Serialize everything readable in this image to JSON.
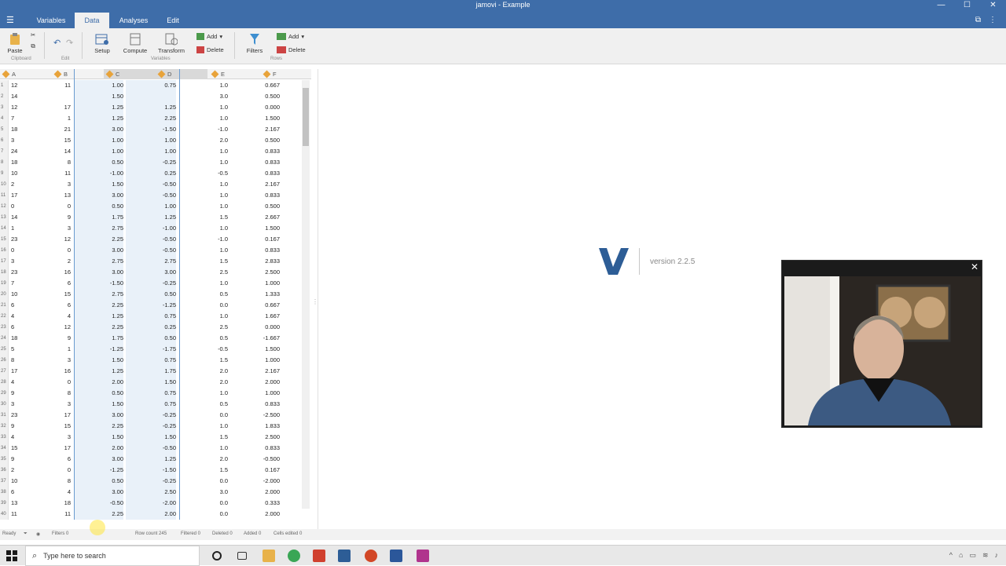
{
  "window": {
    "title": "jamovi - Example",
    "minimize": "—",
    "maximize": "☐",
    "close": "✕"
  },
  "tabs": [
    "Variables",
    "Data",
    "Analyses",
    "Edit"
  ],
  "active_tab": "Data",
  "ribbon": {
    "paste": "Paste",
    "clipboard_group": "Clipboard",
    "edit_group": "Edit",
    "setup": "Setup",
    "compute": "Compute",
    "transform": "Transform",
    "variables_group": "Variables",
    "var_add": "Add",
    "var_delete": "Delete",
    "filters": "Filters",
    "row_add": "Add",
    "row_delete": "Delete",
    "rows_group": "Rows"
  },
  "columns": [
    "A",
    "B",
    "C",
    "D",
    "E",
    "F"
  ],
  "rows": [
    [
      "1",
      "12",
      "11",
      "1.00",
      "0.75",
      "1.0",
      "0.667"
    ],
    [
      "2",
      "14",
      "",
      "1.50",
      "",
      "3.0",
      "0.500"
    ],
    [
      "3",
      "12",
      "17",
      "1.25",
      "1.25",
      "1.0",
      "0.000"
    ],
    [
      "4",
      "7",
      "1",
      "1.25",
      "2.25",
      "1.0",
      "1.500"
    ],
    [
      "5",
      "18",
      "21",
      "3.00",
      "-1.50",
      "-1.0",
      "2.167"
    ],
    [
      "6",
      "3",
      "15",
      "1.00",
      "1.00",
      "2.0",
      "0.500"
    ],
    [
      "7",
      "24",
      "14",
      "1.00",
      "1.00",
      "1.0",
      "0.833"
    ],
    [
      "8",
      "18",
      "8",
      "0.50",
      "-0.25",
      "1.0",
      "0.833"
    ],
    [
      "9",
      "10",
      "11",
      "-1.00",
      "0.25",
      "-0.5",
      "0.833"
    ],
    [
      "10",
      "2",
      "3",
      "1.50",
      "-0.50",
      "1.0",
      "2.167"
    ],
    [
      "11",
      "17",
      "13",
      "3.00",
      "-0.50",
      "1.0",
      "0.833"
    ],
    [
      "12",
      "0",
      "0",
      "0.50",
      "1.00",
      "1.0",
      "0.500"
    ],
    [
      "13",
      "14",
      "9",
      "1.75",
      "1.25",
      "1.5",
      "2.667"
    ],
    [
      "14",
      "1",
      "3",
      "2.75",
      "-1.00",
      "1.0",
      "1.500"
    ],
    [
      "15",
      "23",
      "12",
      "2.25",
      "-0.50",
      "-1.0",
      "0.167"
    ],
    [
      "16",
      "0",
      "0",
      "3.00",
      "-0.50",
      "1.0",
      "0.833"
    ],
    [
      "17",
      "3",
      "2",
      "2.75",
      "2.75",
      "1.5",
      "2.833"
    ],
    [
      "18",
      "23",
      "16",
      "3.00",
      "3.00",
      "2.5",
      "2.500"
    ],
    [
      "19",
      "7",
      "6",
      "-1.50",
      "-0.25",
      "1.0",
      "1.000"
    ],
    [
      "20",
      "10",
      "15",
      "2.75",
      "0.50",
      "0.5",
      "1.333"
    ],
    [
      "21",
      "6",
      "6",
      "2.25",
      "-1.25",
      "0.0",
      "0.667"
    ],
    [
      "22",
      "4",
      "4",
      "1.25",
      "0.75",
      "1.0",
      "1.667"
    ],
    [
      "23",
      "6",
      "12",
      "2.25",
      "0.25",
      "2.5",
      "0.000"
    ],
    [
      "24",
      "18",
      "9",
      "1.75",
      "0.50",
      "0.5",
      "-1.667"
    ],
    [
      "25",
      "5",
      "1",
      "-1.25",
      "-1.75",
      "-0.5",
      "1.500"
    ],
    [
      "26",
      "8",
      "3",
      "1.50",
      "0.75",
      "1.5",
      "1.000"
    ],
    [
      "27",
      "17",
      "16",
      "1.25",
      "1.75",
      "2.0",
      "2.167"
    ],
    [
      "28",
      "4",
      "0",
      "2.00",
      "1.50",
      "2.0",
      "2.000"
    ],
    [
      "29",
      "9",
      "8",
      "0.50",
      "0.75",
      "1.0",
      "1.000"
    ],
    [
      "30",
      "3",
      "3",
      "1.50",
      "0.75",
      "0.5",
      "0.833"
    ],
    [
      "31",
      "23",
      "17",
      "3.00",
      "-0.25",
      "0.0",
      "-2.500"
    ],
    [
      "32",
      "9",
      "15",
      "2.25",
      "-0.25",
      "1.0",
      "1.833"
    ],
    [
      "33",
      "4",
      "3",
      "1.50",
      "1.50",
      "1.5",
      "2.500"
    ],
    [
      "34",
      "15",
      "17",
      "2.00",
      "-0.50",
      "1.0",
      "0.833"
    ],
    [
      "35",
      "9",
      "6",
      "3.00",
      "1.25",
      "2.0",
      "-0.500"
    ],
    [
      "36",
      "2",
      "0",
      "-1.25",
      "-1.50",
      "1.5",
      "0.167"
    ],
    [
      "37",
      "10",
      "8",
      "0.50",
      "-0.25",
      "0.0",
      "-2.000"
    ],
    [
      "38",
      "6",
      "4",
      "3.00",
      "2.50",
      "3.0",
      "2.000"
    ],
    [
      "39",
      "13",
      "18",
      "-0.50",
      "-2.00",
      "0.0",
      "0.333"
    ],
    [
      "40",
      "11",
      "11",
      "2.25",
      "2.00",
      "0.0",
      "2.000"
    ]
  ],
  "results": {
    "version": "version 2.2.5"
  },
  "status": {
    "ready": "Ready",
    "filters": "Filters 0",
    "row_count": "Row count 245",
    "filtered": "Filtered 0",
    "deleted": "Deleted 0",
    "added": "Added 0",
    "cells_edited": "Cells edited 0"
  },
  "video": {
    "close": "✕"
  },
  "taskbar": {
    "search_placeholder": "Type here to search"
  },
  "colors": {
    "accent": "#3e6da9",
    "selected_col_bg": "#e9f1f9",
    "tag": "#e8a33a"
  }
}
